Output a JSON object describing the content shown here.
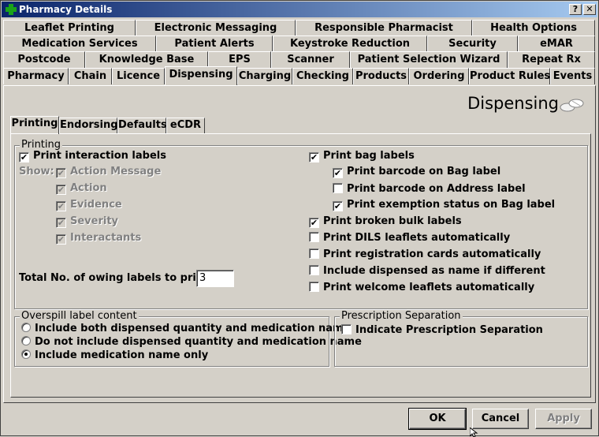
{
  "window": {
    "title": "Pharmacy Details",
    "help_label": "?",
    "close_label": "✕"
  },
  "tab_rows": [
    [
      "Leaflet Printing",
      "Electronic Messaging",
      "Responsible Pharmacist",
      "Health Options"
    ],
    [
      "Medication Services",
      "Patient Alerts",
      "Keystroke Reduction",
      "Security",
      "eMAR"
    ],
    [
      "Postcode",
      "Knowledge Base",
      "EPS",
      "Scanner",
      "Patient Selection Wizard",
      "Repeat Rx"
    ],
    [
      "Pharmacy",
      "Chain",
      "Licence",
      "Dispensing",
      "Charging",
      "Checking",
      "Products",
      "Ordering",
      "Product Rules",
      "Events"
    ]
  ],
  "active_tab": "Dispensing",
  "panel": {
    "title": "Dispensing",
    "icon": "pills-icon"
  },
  "subtabs": [
    "Printing",
    "Endorsing",
    "Defaults",
    "eCDR"
  ],
  "active_subtab": "Printing",
  "printing": {
    "group_label": "Printing",
    "print_interaction_labels": {
      "label": "Print interaction labels",
      "checked": true
    },
    "show_label": "Show:",
    "show_options": [
      {
        "label": "Action Message",
        "checked": true
      },
      {
        "label": "Action",
        "checked": true
      },
      {
        "label": "Evidence",
        "checked": true
      },
      {
        "label": "Severity",
        "checked": true
      },
      {
        "label": "Interactants",
        "checked": true
      }
    ],
    "owing_labels": {
      "label": "Total No. of owing labels to print:",
      "value": "3"
    },
    "right_options": [
      {
        "label": "Print bag labels",
        "checked": true
      },
      {
        "label": "Print barcode on Bag label",
        "checked": true
      },
      {
        "label": "Print barcode on Address label",
        "checked": false
      },
      {
        "label": "Print exemption status on Bag label",
        "checked": true
      },
      {
        "label": "Print broken bulk labels",
        "checked": true
      },
      {
        "label": "Print DILS leaflets automatically",
        "checked": false
      },
      {
        "label": "Print registration cards automatically",
        "checked": false
      },
      {
        "label": "Include dispensed as name if different",
        "checked": false
      },
      {
        "label": "Print welcome leaflets automatically",
        "checked": false
      }
    ]
  },
  "overspill": {
    "group_label": "Overspill label content",
    "options": [
      {
        "label": "Include both dispensed quantity and medication name",
        "selected": false
      },
      {
        "label": "Do not include dispensed quantity and medication name",
        "selected": false
      },
      {
        "label": "Include medication name only",
        "selected": true
      }
    ]
  },
  "separation": {
    "group_label": "Prescription Separation",
    "option": {
      "label": "Indicate Prescription Separation",
      "checked": false
    }
  },
  "buttons": {
    "ok": "OK",
    "cancel": "Cancel",
    "apply": "Apply"
  },
  "check_glyph": "✔"
}
